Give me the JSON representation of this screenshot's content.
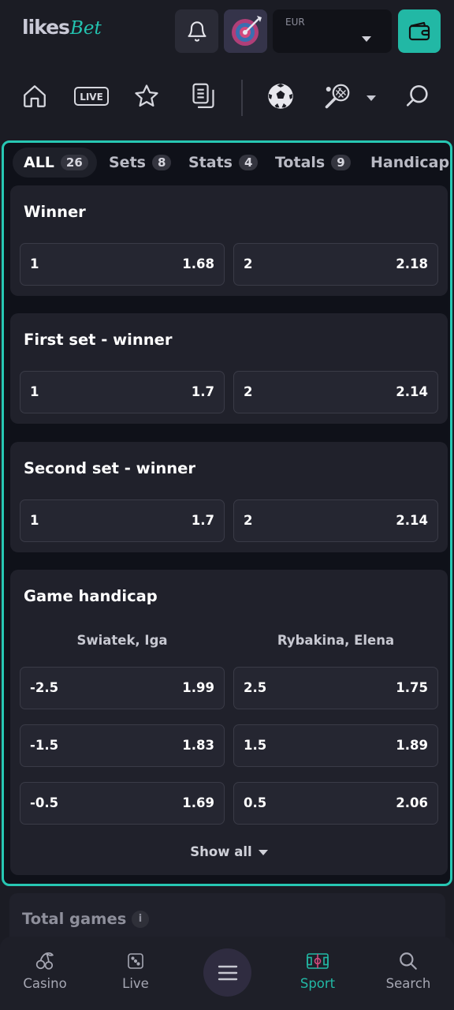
{
  "header": {
    "logo_main": "likes",
    "logo_accent": "Bet",
    "currency": "EUR",
    "icons": [
      "bell-icon",
      "avatar",
      "wallet-icon"
    ],
    "accent_color": "#22b8a5"
  },
  "nav": {
    "live_label": "LIVE",
    "icons": [
      "home-icon",
      "live-icon",
      "star-icon",
      "coupon-icon",
      "soccer-ball-icon",
      "tennis-racket-icon",
      "chevron-down-icon",
      "search-icon"
    ]
  },
  "tabs": [
    {
      "label": "ALL",
      "count": "26"
    },
    {
      "label": "Sets",
      "count": "8"
    },
    {
      "label": "Stats",
      "count": "4"
    },
    {
      "label": "Totals",
      "count": "9"
    },
    {
      "label": "Handicap",
      "count": ""
    }
  ],
  "markets": {
    "winner": {
      "title": "Winner",
      "odds": [
        {
          "label": "1",
          "value": "1.68"
        },
        {
          "label": "2",
          "value": "2.18"
        }
      ]
    },
    "first_set": {
      "title": "First set - winner",
      "odds": [
        {
          "label": "1",
          "value": "1.7"
        },
        {
          "label": "2",
          "value": "2.14"
        }
      ]
    },
    "second_set": {
      "title": "Second set - winner",
      "odds": [
        {
          "label": "1",
          "value": "1.7"
        },
        {
          "label": "2",
          "value": "2.14"
        }
      ]
    },
    "handicap": {
      "title": "Game handicap",
      "players": [
        "Swiatek, Iga",
        "Rybakina, Elena"
      ],
      "rows": [
        [
          {
            "label": "-2.5",
            "value": "1.99"
          },
          {
            "label": "2.5",
            "value": "1.75"
          }
        ],
        [
          {
            "label": "-1.5",
            "value": "1.83"
          },
          {
            "label": "1.5",
            "value": "1.89"
          }
        ],
        [
          {
            "label": "-0.5",
            "value": "1.69"
          },
          {
            "label": "0.5",
            "value": "2.06"
          }
        ]
      ],
      "show_all": "Show all"
    }
  },
  "next_market": {
    "title": "Total games",
    "info": "i"
  },
  "bottom_nav": {
    "items": [
      {
        "label": "Casino",
        "icon": "cherries-icon"
      },
      {
        "label": "Live",
        "icon": "dice-icon"
      },
      {
        "label": "",
        "icon": "menu-icon"
      },
      {
        "label": "Sport",
        "icon": "sport-field-icon",
        "active": true
      },
      {
        "label": "Search",
        "icon": "search-icon"
      }
    ]
  }
}
